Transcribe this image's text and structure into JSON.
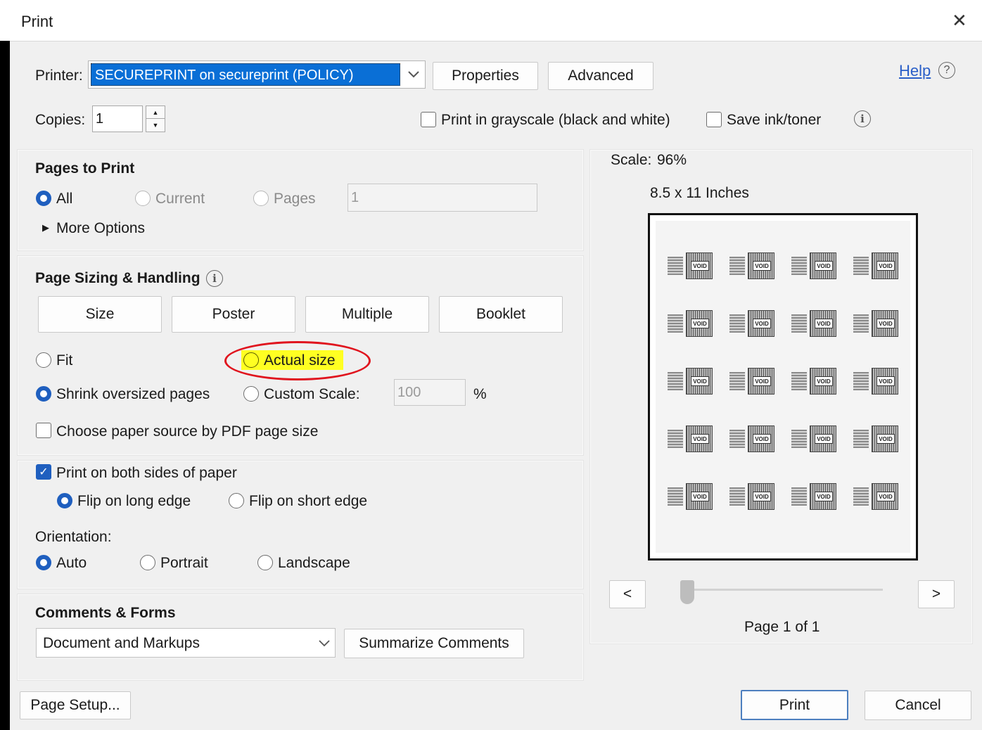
{
  "window": {
    "title": "Print",
    "close_glyph": "✕"
  },
  "printer": {
    "label": "Printer:",
    "selected": "SECUREPRINT on secureprint (POLICY)",
    "properties_label": "Properties",
    "advanced_label": "Advanced",
    "help_label": "Help",
    "help_glyph": "?"
  },
  "copies": {
    "label": "Copies:",
    "value": "1",
    "grayscale_label": "Print in grayscale (black and white)",
    "grayscale_checked": false,
    "save_ink_label": "Save ink/toner",
    "save_ink_checked": false,
    "info_glyph": "i"
  },
  "pages_to_print": {
    "title": "Pages to Print",
    "all_label": "All",
    "current_label": "Current",
    "pages_label": "Pages",
    "pages_value": "1",
    "selected": "All",
    "more_options_label": "More Options",
    "more_options_glyph": "▶"
  },
  "page_sizing": {
    "title": "Page Sizing & Handling",
    "info_glyph": "i",
    "tabs": [
      {
        "label": "Size"
      },
      {
        "label": "Poster"
      },
      {
        "label": "Multiple"
      },
      {
        "label": "Booklet"
      }
    ],
    "fit_label": "Fit",
    "actual_size_label": "Actual size",
    "shrink_label": "Shrink oversized pages",
    "custom_scale_label": "Custom Scale:",
    "custom_scale_value": "100",
    "percent_label": "%",
    "selected": "Shrink oversized pages",
    "paper_source_label": "Choose paper source by PDF page size",
    "paper_source_checked": false
  },
  "duplex": {
    "both_sides_label": "Print on both sides of paper",
    "both_sides_checked": true,
    "check_glyph": "✓",
    "long_edge_label": "Flip on long edge",
    "short_edge_label": "Flip on short edge",
    "selected": "Flip on long edge",
    "orientation_label": "Orientation:",
    "auto_label": "Auto",
    "portrait_label": "Portrait",
    "landscape_label": "Landscape",
    "orientation_selected": "Auto"
  },
  "comments_forms": {
    "title": "Comments & Forms",
    "selected": "Document and Markups",
    "summarize_label": "Summarize Comments"
  },
  "preview": {
    "scale_label": "Scale:",
    "scale_value": "96%",
    "paper_size": "8.5 x 11 Inches",
    "prev_glyph": "<",
    "next_glyph": ">",
    "page_indicator": "Page 1 of 1",
    "void_text": "VOID",
    "grid_cols": 4,
    "grid_rows": 5,
    "slider_position": 0
  },
  "footer": {
    "page_setup_label": "Page Setup...",
    "print_label": "Print",
    "cancel_label": "Cancel"
  },
  "colors": {
    "accent": "#1f5fbf",
    "selection": "#0a6fd6",
    "annotation_ring": "#e0141e",
    "highlight": "#ffff22"
  },
  "icons": {
    "dropdown": "chevron-down-icon",
    "help": "question-circle-icon",
    "info": "info-circle-icon",
    "close": "close-icon"
  }
}
